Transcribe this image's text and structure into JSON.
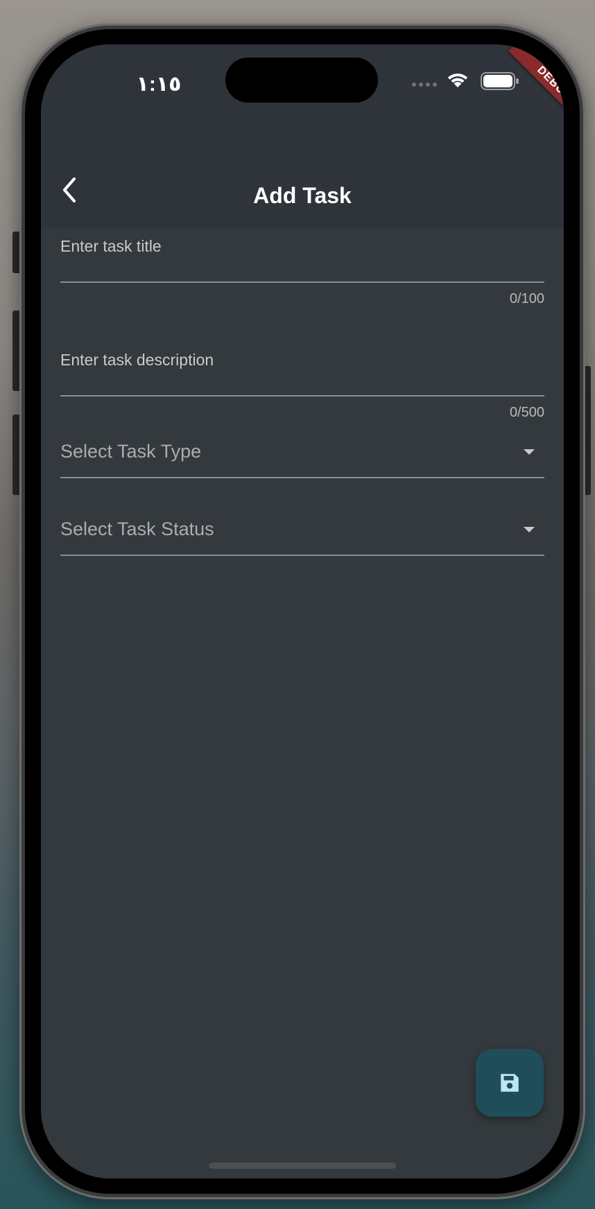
{
  "status_bar": {
    "time": "١:١٥",
    "debug_banner": "DEBUG"
  },
  "app_bar": {
    "title": "Add Task"
  },
  "form": {
    "title_field": {
      "label": "Enter task title",
      "value": "",
      "counter": "0/100"
    },
    "description_field": {
      "label": "Enter task description",
      "value": "",
      "counter": "0/500"
    },
    "type_dropdown": {
      "placeholder": "Select Task Type"
    },
    "status_dropdown": {
      "placeholder": "Select Task Status"
    }
  },
  "icons": {
    "back": "chevron-left-icon",
    "dropdown": "caret-down-icon",
    "save": "floppy-disk-icon",
    "wifi": "wifi-icon",
    "battery": "battery-icon"
  },
  "colors": {
    "background": "#33393c",
    "app_bar": "#2f343b",
    "fab": "#1f4e5a",
    "fab_icon": "#bfe7f3",
    "debug_banner": "#8a2a2a"
  }
}
